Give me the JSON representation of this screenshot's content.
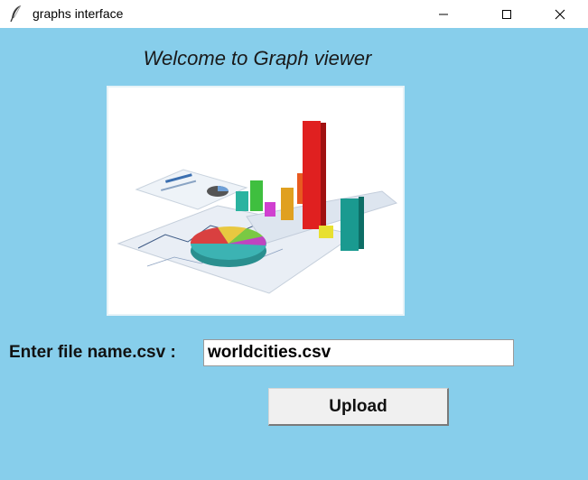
{
  "window": {
    "title": "graphs interface",
    "controls": {
      "minimize": "minimize",
      "maximize": "maximize",
      "close": "close"
    }
  },
  "main": {
    "welcome": "Welcome to Graph viewer",
    "file_label": "Enter file name.csv :",
    "file_input_value": "worldcities.csv",
    "upload_label": "Upload"
  },
  "colors": {
    "background": "#87ceeb",
    "button": "#f0f0f0"
  },
  "icons": {
    "app": "feather-icon",
    "image": "charts-illustration"
  }
}
